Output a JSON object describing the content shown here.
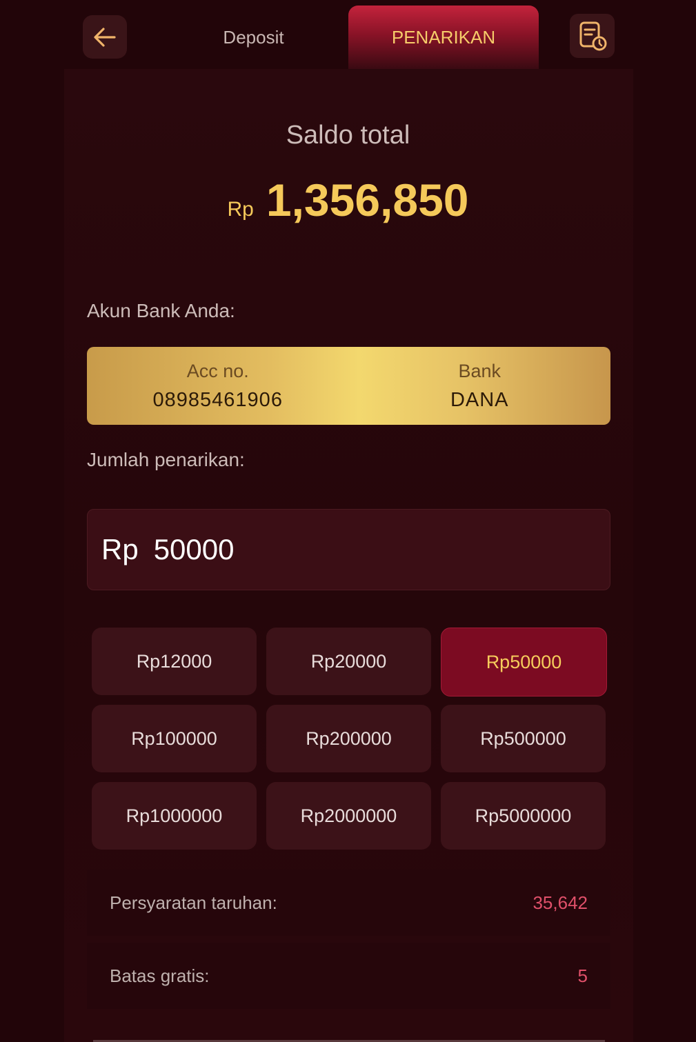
{
  "header": {
    "back_icon": "arrow-left-icon",
    "tabs": [
      {
        "label": "Deposit",
        "active": false
      },
      {
        "label": "PENARIKAN",
        "active": true
      }
    ],
    "history_icon": "document-history-icon"
  },
  "balance": {
    "label": "Saldo total",
    "currency": "Rp",
    "amount": "1,356,850"
  },
  "bank": {
    "section_label": "Akun Bank Anda:",
    "acc_label": "Acc no.",
    "acc_value": "08985461906",
    "bank_label": "Bank",
    "bank_value": "DANA"
  },
  "withdraw": {
    "section_label": "Jumlah penarikan:",
    "currency": "Rp",
    "value": "50000",
    "presets": [
      "Rp12000",
      "Rp20000",
      "Rp50000",
      "Rp100000",
      "Rp200000",
      "Rp500000",
      "Rp1000000",
      "Rp2000000",
      "Rp5000000"
    ],
    "selected_preset": "Rp50000"
  },
  "info": {
    "wager_label": "Persyaratan taruhan:",
    "wager_value": "35,642",
    "free_limit_label": "Batas gratis:",
    "free_limit_value": "5"
  },
  "colors": {
    "background": "#220509",
    "accent_gold": "#f5c95a",
    "active_tab": "#8a1327",
    "preset_active": "#7c0b22",
    "info_value": "#e0506a"
  }
}
